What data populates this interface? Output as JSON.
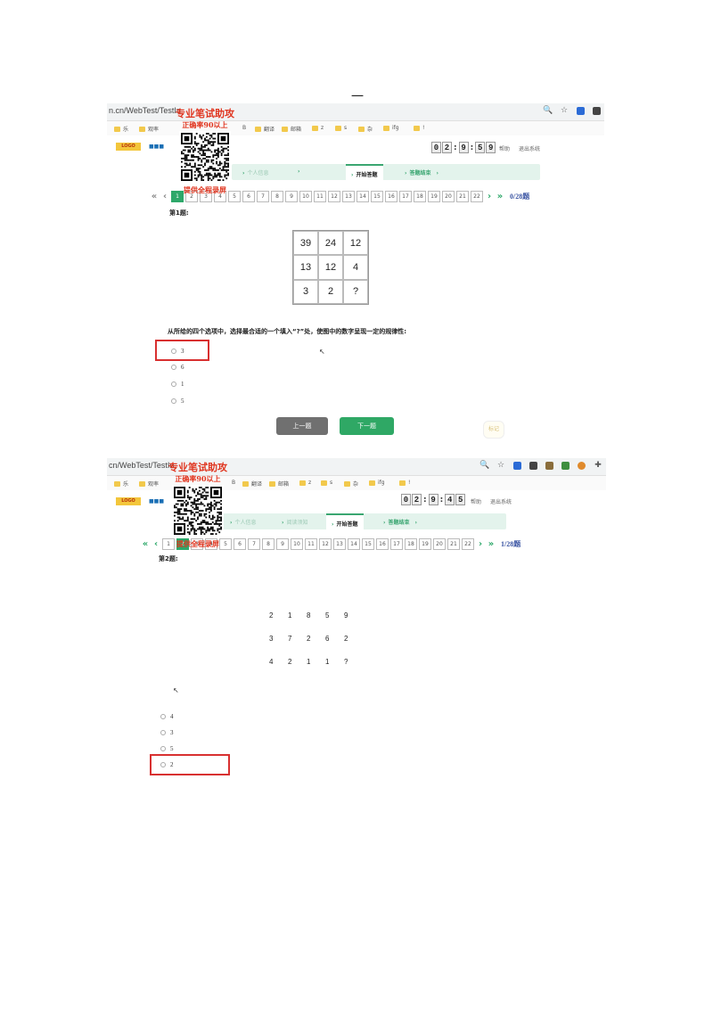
{
  "page_mark": "一",
  "colors": {
    "accent": "#2ea86a",
    "highlight": "#d83030",
    "ad_red": "#e0351f",
    "count": "#3b55a3"
  },
  "promo": {
    "line1": "专业笔试助攻",
    "line2": "正确率90以上",
    "line3": "提供全程录屏"
  },
  "shot1": {
    "url": "n.cn/WebTest/TestIn",
    "bar_icons": [
      "zoom-icon",
      "star-icon",
      "extension-icon",
      "menu-icon"
    ],
    "bookmarks": [
      "乐",
      "观率",
      "B",
      "翻译",
      "邮箱",
      "z",
      "s",
      "杂",
      "ifg",
      "!"
    ],
    "timer": [
      "0",
      "2",
      "9",
      "5",
      "9"
    ],
    "header_links": [
      "帮助",
      "退出系统"
    ],
    "steps": {
      "s1": "个人信息",
      "s2": "开始答题",
      "s3": "答题结束"
    },
    "question_numbers": [
      "1",
      "2",
      "3",
      "4",
      "5",
      "6",
      "7",
      "8",
      "9",
      "10",
      "11",
      "12",
      "13",
      "14",
      "15",
      "16",
      "17",
      "18",
      "19",
      "20",
      "21",
      "22"
    ],
    "count": "0/28题",
    "question_title": "第1题:",
    "grid": [
      "39",
      "24",
      "12",
      "13",
      "12",
      "4",
      "3",
      "2",
      "?"
    ],
    "stem": "从所给的四个选项中，选择最合适的一个填入“?”处，使图中的数字呈现一定的规律性:",
    "options": [
      "3",
      "6",
      "1",
      "5"
    ],
    "prev_label": "上一题",
    "next_label": "下一题",
    "mark_label": "标记"
  },
  "shot2": {
    "url": "cn/WebTest/TestIn",
    "bar_icons": [
      "zoom-icon",
      "star-icon",
      "extension-icon",
      "menu-icon",
      "image-icon",
      "leaf-icon",
      "orange-icon",
      "puzzle-icon"
    ],
    "bookmarks": [
      "乐",
      "观率",
      "B",
      "翻译",
      "邮箱",
      "z",
      "s",
      "杂",
      "ifg",
      "!"
    ],
    "timer": [
      "0",
      "2",
      "9",
      "4",
      "5"
    ],
    "header_links": [
      "帮助",
      "退出系统"
    ],
    "steps": {
      "s1": "个人信息",
      "s1b": "阅读须知",
      "s2": "开始答题",
      "s3": "答题结束"
    },
    "question_numbers": [
      "1",
      "2",
      "3",
      "4",
      "5",
      "6",
      "7",
      "8",
      "9",
      "10",
      "11",
      "12",
      "13",
      "14",
      "15",
      "16",
      "17",
      "18",
      "19",
      "20",
      "21",
      "22"
    ],
    "count": "1/28题",
    "question_title": "第2题:",
    "sequence": [
      [
        "2",
        "1",
        "8",
        "5",
        "9"
      ],
      [
        "3",
        "7",
        "2",
        "6",
        "2"
      ],
      [
        "4",
        "2",
        "1",
        "1",
        "?"
      ]
    ],
    "options": [
      "4",
      "3",
      "5",
      "2"
    ]
  }
}
